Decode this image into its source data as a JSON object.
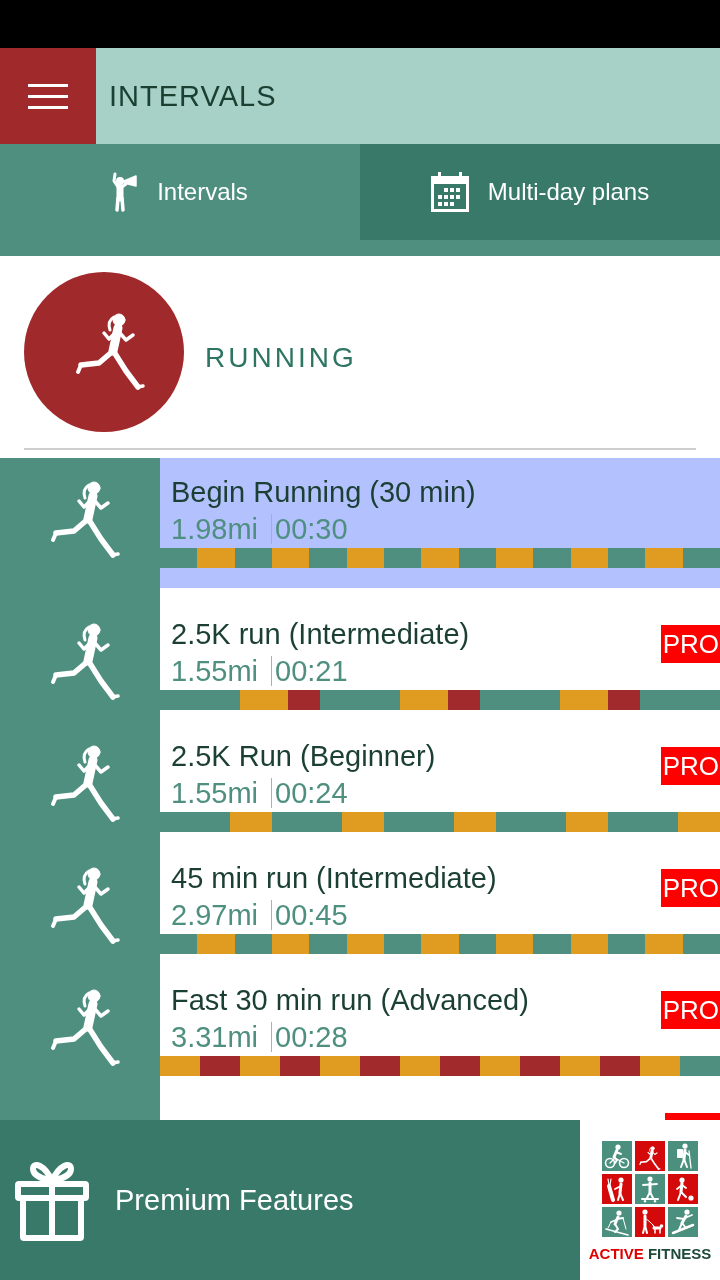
{
  "header": {
    "title": "INTERVALS"
  },
  "tabs": [
    {
      "label": "Intervals",
      "kind": "intervals",
      "selected": true
    },
    {
      "label": "Multi-day plans",
      "kind": "plans",
      "selected": false
    }
  ],
  "category": {
    "title": "RUNNING"
  },
  "workouts": [
    {
      "title": "Begin Running (30 min)",
      "distance": "1.98mi",
      "duration": "00:30",
      "selected": true,
      "pro": false,
      "segments": [
        {
          "kind": "medium",
          "color": "#4f8f80"
        },
        {
          "kind": "medium",
          "color": "#e09b21"
        },
        {
          "kind": "medium",
          "color": "#4f8f80"
        },
        {
          "kind": "medium",
          "color": "#e09b21"
        },
        {
          "kind": "medium",
          "color": "#4f8f80"
        },
        {
          "kind": "medium",
          "color": "#e09b21"
        },
        {
          "kind": "medium",
          "color": "#4f8f80"
        },
        {
          "kind": "medium",
          "color": "#e09b21"
        },
        {
          "kind": "medium",
          "color": "#4f8f80"
        },
        {
          "kind": "medium",
          "color": "#e09b21"
        },
        {
          "kind": "medium",
          "color": "#4f8f80"
        },
        {
          "kind": "medium",
          "color": "#e09b21"
        },
        {
          "kind": "medium",
          "color": "#4f8f80"
        },
        {
          "kind": "medium",
          "color": "#e09b21"
        },
        {
          "kind": "medium",
          "color": "#4f8f80"
        }
      ]
    },
    {
      "title": "2.5K run (Intermediate)",
      "distance": "1.55mi",
      "duration": "00:21",
      "selected": false,
      "pro": true,
      "badge_text": "PRO",
      "segments": [
        {
          "kind": "long",
          "color": "#4f8f80"
        },
        {
          "kind": "medium",
          "color": "#e09b21"
        },
        {
          "kind": "short",
          "color": "#a02a2c"
        },
        {
          "kind": "long",
          "color": "#4f8f80"
        },
        {
          "kind": "medium",
          "color": "#e09b21"
        },
        {
          "kind": "short",
          "color": "#a02a2c"
        },
        {
          "kind": "long",
          "color": "#4f8f80"
        },
        {
          "kind": "medium",
          "color": "#e09b21"
        },
        {
          "kind": "short",
          "color": "#a02a2c"
        },
        {
          "kind": "long",
          "color": "#4f8f80"
        }
      ]
    },
    {
      "title": "2.5K Run (Beginner)",
      "distance": "1.55mi",
      "duration": "00:24",
      "selected": false,
      "pro": true,
      "badge_text": "PRO",
      "segments": [
        {
          "kind": "long",
          "color": "#4f8f80"
        },
        {
          "kind": "medium",
          "color": "#e09b21"
        },
        {
          "kind": "long",
          "color": "#4f8f80"
        },
        {
          "kind": "medium",
          "color": "#e09b21"
        },
        {
          "kind": "long",
          "color": "#4f8f80"
        },
        {
          "kind": "medium",
          "color": "#e09b21"
        },
        {
          "kind": "long",
          "color": "#4f8f80"
        },
        {
          "kind": "medium",
          "color": "#e09b21"
        },
        {
          "kind": "long",
          "color": "#4f8f80"
        },
        {
          "kind": "medium",
          "color": "#e09b21"
        }
      ]
    },
    {
      "title": "45 min run (Intermediate)",
      "distance": "2.97mi",
      "duration": "00:45",
      "selected": false,
      "pro": true,
      "badge_text": "PRO",
      "segments": [
        {
          "kind": "medium",
          "color": "#4f8f80"
        },
        {
          "kind": "medium",
          "color": "#e09b21"
        },
        {
          "kind": "medium",
          "color": "#4f8f80"
        },
        {
          "kind": "medium",
          "color": "#e09b21"
        },
        {
          "kind": "medium",
          "color": "#4f8f80"
        },
        {
          "kind": "medium",
          "color": "#e09b21"
        },
        {
          "kind": "medium",
          "color": "#4f8f80"
        },
        {
          "kind": "medium",
          "color": "#e09b21"
        },
        {
          "kind": "medium",
          "color": "#4f8f80"
        },
        {
          "kind": "medium",
          "color": "#e09b21"
        },
        {
          "kind": "medium",
          "color": "#4f8f80"
        },
        {
          "kind": "medium",
          "color": "#e09b21"
        },
        {
          "kind": "medium",
          "color": "#4f8f80"
        },
        {
          "kind": "medium",
          "color": "#e09b21"
        },
        {
          "kind": "medium",
          "color": "#4f8f80"
        }
      ]
    },
    {
      "title": "Fast 30 min run (Advanced)",
      "distance": "3.31mi",
      "duration": "00:28",
      "selected": false,
      "pro": true,
      "badge_text": "PRO",
      "segments": [
        {
          "kind": "medium",
          "color": "#e09b21"
        },
        {
          "kind": "medium",
          "color": "#a02a2c"
        },
        {
          "kind": "medium",
          "color": "#e09b21"
        },
        {
          "kind": "medium",
          "color": "#a02a2c"
        },
        {
          "kind": "medium",
          "color": "#e09b21"
        },
        {
          "kind": "medium",
          "color": "#a02a2c"
        },
        {
          "kind": "medium",
          "color": "#e09b21"
        },
        {
          "kind": "medium",
          "color": "#a02a2c"
        },
        {
          "kind": "medium",
          "color": "#e09b21"
        },
        {
          "kind": "medium",
          "color": "#a02a2c"
        },
        {
          "kind": "medium",
          "color": "#e09b21"
        },
        {
          "kind": "medium",
          "color": "#a02a2c"
        },
        {
          "kind": "medium",
          "color": "#e09b21"
        },
        {
          "kind": "medium",
          "color": "#4f8f80"
        }
      ]
    },
    {
      "selected": false,
      "pro": true
    }
  ],
  "premium": {
    "label": "Premium Features"
  },
  "logo": {
    "first_word": "ACTIVE",
    "second_word": "FITNESS"
  }
}
